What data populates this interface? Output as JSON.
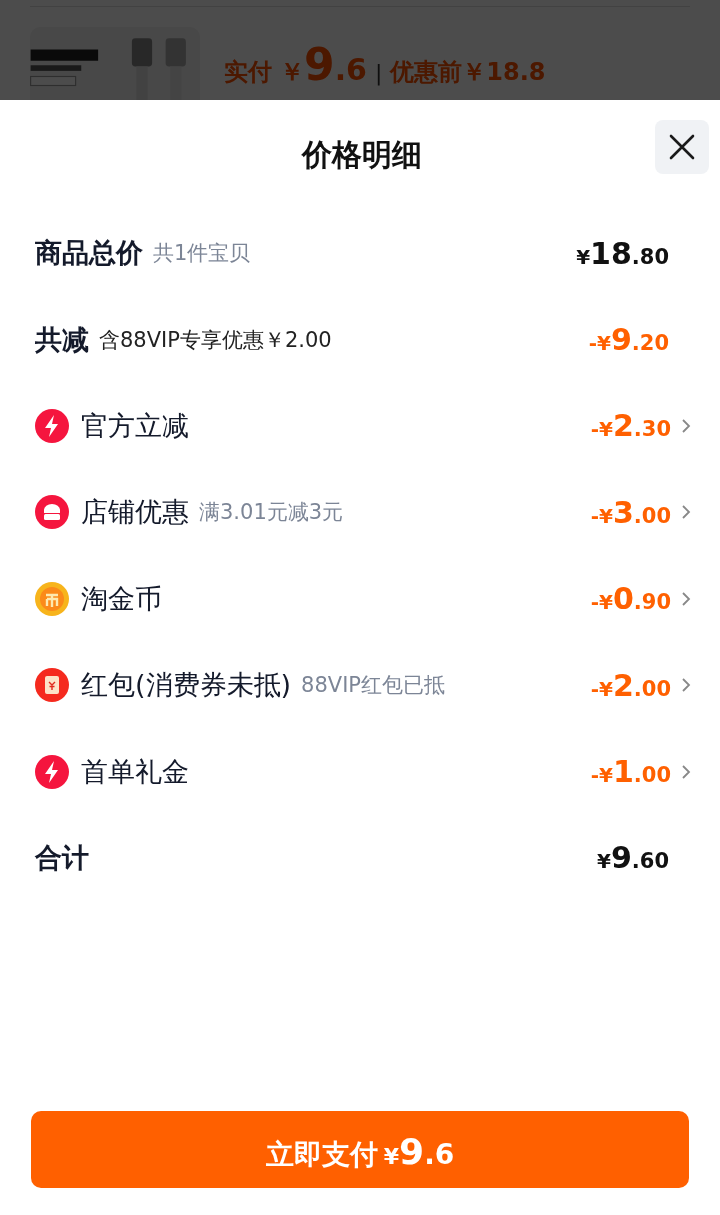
{
  "background": {
    "paid_label": "实付",
    "paid_currency": "￥",
    "paid_int": "9",
    "paid_dec": ".6",
    "divider": "|",
    "before_label": "优惠前￥18.8"
  },
  "sheet": {
    "title": "价格明细",
    "rows": [
      {
        "kind": "summary",
        "label": "商品总价",
        "note": "共1件宝贝",
        "price": {
          "prefix": "¥",
          "int": "18",
          "dec": ".80"
        }
      },
      {
        "kind": "reduction",
        "label": "共减",
        "note": "含88VIP专享优惠￥2.00",
        "price": {
          "prefix": "-¥",
          "int": "9",
          "dec": ".20"
        }
      },
      {
        "kind": "discount",
        "label": "官方立减",
        "price": {
          "prefix": "-¥",
          "int": "2",
          "dec": ".30"
        }
      },
      {
        "kind": "discount",
        "label": "店铺优惠",
        "note": "满3.01元减3元",
        "price": {
          "prefix": "-¥",
          "int": "3",
          "dec": ".00"
        }
      },
      {
        "kind": "discount",
        "label": "淘金币",
        "price": {
          "prefix": "-¥",
          "int": "0",
          "dec": ".90"
        }
      },
      {
        "kind": "discount",
        "label": "红包(消费券未抵)",
        "note": "88VIP红包已抵",
        "price": {
          "prefix": "-¥",
          "int": "2",
          "dec": ".00"
        }
      },
      {
        "kind": "discount",
        "label": "首单礼金",
        "price": {
          "prefix": "-¥",
          "int": "1",
          "dec": ".00"
        }
      },
      {
        "kind": "summary",
        "label": "合计",
        "price": {
          "prefix": "¥",
          "int": "9",
          "dec": ".60"
        }
      }
    ],
    "pay_button": {
      "label": "立即支付",
      "prefix": "¥",
      "int": "9",
      "dec": ".6"
    }
  }
}
